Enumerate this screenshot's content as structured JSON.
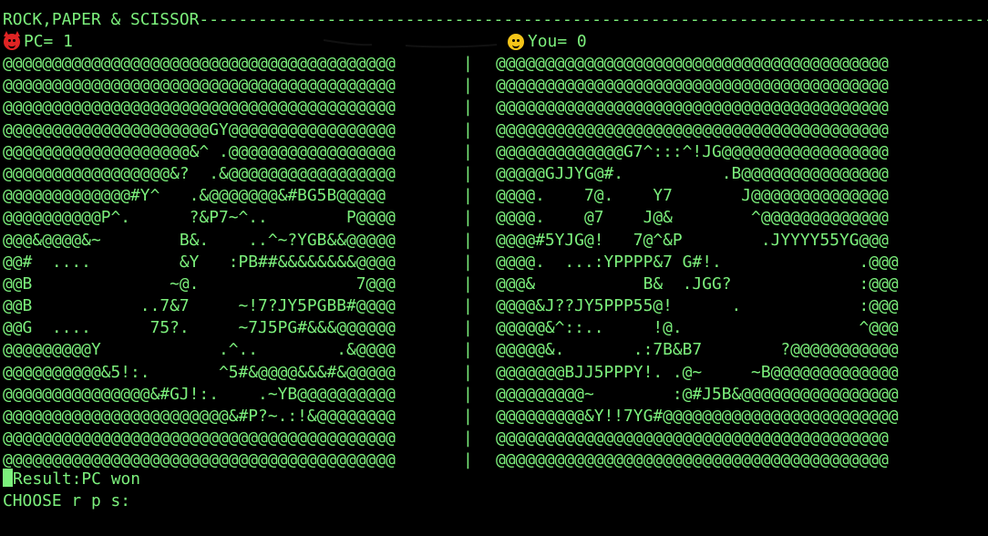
{
  "title_line": "ROCK,PAPER & SCISSOR---------------------------------------------------------------------------------------------",
  "pc_score": {
    "icon": "devil-face-icon",
    "label": "PC= 1"
  },
  "you_score": {
    "icon": "smiling-face-icon",
    "label": "You= 0"
  },
  "colors": {
    "text": "#7cf07c",
    "background": "#000000",
    "pc_icon": "#e02424",
    "you_icon": "#f5c518"
  },
  "divider_char": "|",
  "left_art": [
    "@@@@@@@@@@@@@@@@@@@@@@@@@@@@@@@@@@@@@@@@",
    "@@@@@@@@@@@@@@@@@@@@@@@@@@@@@@@@@@@@@@@@",
    "@@@@@@@@@@@@@@@@@@@@@@@@@@@@@@@@@@@@@@@@",
    "@@@@@@@@@@@@@@@@@@@@@GY@@@@@@@@@@@@@@@@@",
    "@@@@@@@@@@@@@@@@@@@&^ .@@@@@@@@@@@@@@@@@",
    "@@@@@@@@@@@@@@@@@&?  .&@@@@@@@@@@@@@@@@@",
    "@@@@@@@@@@@@@#Y^   .&@@@@@@@&#BG5B@@@@@",
    "@@@@@@@@@@P^.      ?&P7~^..        P@@@@",
    "@@@&@@@@&~        B&.    ..^~?YGB&&@@@@@",
    "@@#  ....         &Y   :PB##&&&&&&&&@@@@",
    "@@B              ~@.                7@@@",
    "@@B           ..7&7     ~!7?JY5PGBB#@@@@",
    "@@G  ....      75?.     ~7J5PG#&&&@@@@@@",
    "@@@@@@@@@Y            .^..        .&@@@@",
    "@@@@@@@@@@&5!:.       ^5#&@@@@&&&#&@@@@@",
    "@@@@@@@@@@@@@@@&#GJ!:.    .~YB@@@@@@@@@@",
    "@@@@@@@@@@@@@@@@@@@@@@@&#P?~.:!&@@@@@@@@",
    "@@@@@@@@@@@@@@@@@@@@@@@@@@@@@@@@@@@@@@@@",
    "@@@@@@@@@@@@@@@@@@@@@@@@@@@@@@@@@@@@@@@@"
  ],
  "right_art": [
    "@@@@@@@@@@@@@@@@@@@@@@@@@@@@@@@@@@@@@@@@",
    "@@@@@@@@@@@@@@@@@@@@@@@@@@@@@@@@@@@@@@@@",
    "@@@@@@@@@@@@@@@@@@@@@@@@@@@@@@@@@@@@@@@@",
    "@@@@@@@@@@@@@@@@@@@@@@@@@@@@@@@@@@@@@@@@",
    "@@@@@@@@@@@@@G7^:::^!JG@@@@@@@@@@@@@@@@@",
    "@@@@@GJJYG@#.          .B@@@@@@@@@@@@@@@",
    "@@@@.    7@.    Y7       J@@@@@@@@@@@@@@",
    "@@@@.    @7    J@&        ^@@@@@@@@@@@@@",
    "@@@@#5YJG@!   7@^&P        .JYYYY55YG@@@",
    "@@@@.  ...:YPPPP&7 G#!.              .@@@",
    "@@@&           B&  .JGG?             :@@@",
    "@@@@&J??JY5PPP55@!      .            :@@@",
    "@@@@@&^::..     !@.                  ^@@@",
    "@@@@@&.       .:7B&B7        ?@@@@@@@@@@@",
    "@@@@@@@BJJ5PPPY!. .@~     ~B@@@@@@@@@@@@@",
    "@@@@@@@@@~        :@#J5B&@@@@@@@@@@@@@@@@",
    "@@@@@@@@@&Y!!7YG#@@@@@@@@@@@@@@@@@@@@@@@@",
    "@@@@@@@@@@@@@@@@@@@@@@@@@@@@@@@@@@@@@@@@",
    "@@@@@@@@@@@@@@@@@@@@@@@@@@@@@@@@@@@@@@@@"
  ],
  "result_line": "Result:PC won",
  "prompt_line": "CHOOSE r p s:"
}
